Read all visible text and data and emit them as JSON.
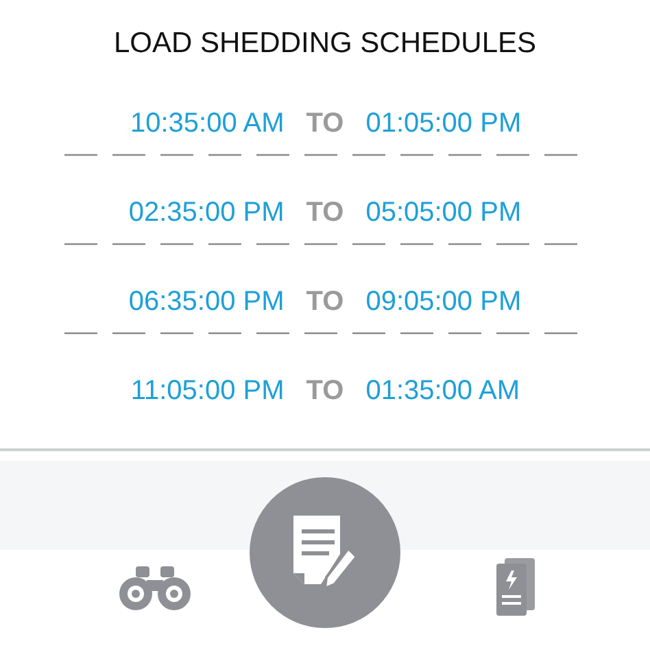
{
  "title": "LOAD SHEDDING SCHEDULES",
  "schedules": [
    {
      "start": "10:35:00 AM",
      "separator": "TO",
      "end": "01:05:00 PM"
    },
    {
      "start": "02:35:00 PM",
      "separator": "TO",
      "end": "05:05:00 PM"
    },
    {
      "start": "06:35:00 PM",
      "separator": "TO",
      "end": "09:05:00 PM"
    },
    {
      "start": "11:05:00 PM",
      "separator": "TO",
      "end": "01:35:00 AM"
    }
  ]
}
